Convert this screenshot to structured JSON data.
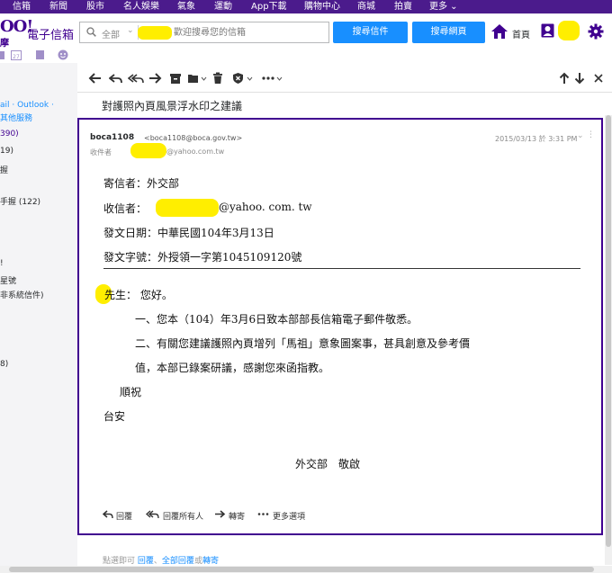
{
  "top_nav": {
    "items": [
      "信箱",
      "新聞",
      "股市",
      "名人娛樂",
      "氣象",
      "運動",
      "App下載",
      "購物中心",
      "商城",
      "拍賣",
      "更多 ⌄"
    ]
  },
  "header": {
    "logo_text": "OO!",
    "logo_sub": "摩",
    "product_name": "電子信箱",
    "search_scope": "全部",
    "search_placeholder": "歡迎搜尋您的信箱",
    "search_mail_button": "搜尋信件",
    "search_web_button": "搜尋網頁",
    "home_label": "首頁"
  },
  "sidebar": {
    "items": [
      {
        "label": "ail · Outlook ·",
        "color": "#188fff"
      },
      {
        "label": "其他服務",
        "color": "#188fff"
      },
      {
        "label": "390)",
        "color": "#400090"
      },
      {
        "label": "19)",
        "color": "#26282a"
      },
      {
        "label": "握",
        "color": "#26282a"
      },
      {
        "label": "手握 (122)",
        "color": "#26282a"
      },
      {
        "label": "!",
        "color": "#26282a"
      },
      {
        "label": "星號",
        "color": "#26282a"
      },
      {
        "label": "非系統信件)",
        "color": "#26282a"
      },
      {
        "label": "8)",
        "color": "#26282a"
      }
    ]
  },
  "message": {
    "subject": "對護照內頁風景浮水印之建議",
    "from_name": "boca1108",
    "from_email": "<boca1108@boca.gov.tw>",
    "to_label": "收件者",
    "to_email": "@yahoo.com.tw",
    "date": "2015/03/13 於 3:31 PM",
    "letter": {
      "sender_line": "寄信者：外交部",
      "recipient_label": "收信者：",
      "recipient_email": "@yahoo. com. tw",
      "date_line": "發文日期：中華民國104年3月13日",
      "ref_line": "發文字號：外授領一字第1045109120號",
      "greeting": "先生：  您好。",
      "para1": "一、您本（104）年3月6日致本部部長信箱電子郵件敬悉。",
      "para2a": "二、有關您建議護照內頁增列「馬祖」意象圖案事，甚具創意及參考價",
      "para2b": "值，本部已錄案研議，感謝您來函指教。",
      "closing1": "順祝",
      "closing2": "台安",
      "signature": "外交部　敬啟"
    },
    "actions": {
      "reply": "回覆",
      "reply_all": "回覆所有人",
      "forward": "轉寄",
      "more": "更多選項"
    }
  },
  "bottom_hint": {
    "prefix": "點選即可",
    "reply": "回覆",
    "sep": "、",
    "reply_all": "全部回覆",
    "or": "或",
    "forward": "轉寄"
  },
  "colors": {
    "brand_purple": "#400090",
    "nav_purple": "#4b1b8c",
    "button_blue": "#188fff",
    "redaction_yellow": "#ffee00"
  }
}
